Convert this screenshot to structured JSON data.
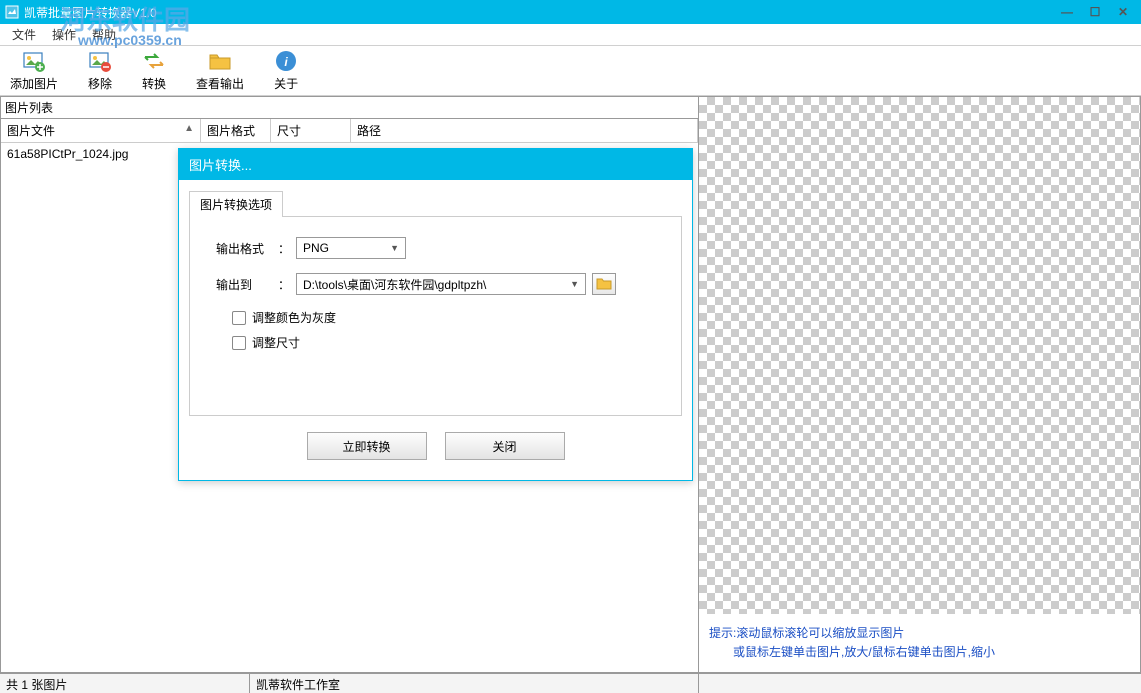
{
  "window": {
    "title": "凯蒂批量图片转换器V1.0"
  },
  "menubar": {
    "file": "文件",
    "operate": "操作",
    "help": "帮助"
  },
  "toolbar": {
    "add_image": "添加图片",
    "remove": "移除",
    "convert": "转换",
    "view_output": "查看输出",
    "about": "关于"
  },
  "watermark": {
    "text": "河东软件园",
    "url": "www.pc0359.cn"
  },
  "left_panel": {
    "title": "图片列表",
    "columns": {
      "file": "图片文件",
      "format": "图片格式",
      "size": "尺寸",
      "path": "路径"
    },
    "rows": [
      {
        "file": "61a58PICtPr_1024.jpg",
        "format": "",
        "size": "",
        "path": ""
      }
    ]
  },
  "hints": {
    "line1": "提示:滚动鼠标滚轮可以缩放显示图片",
    "line2": "　　或鼠标左键单击图片,放大/鼠标右键单击图片,缩小"
  },
  "statusbar": {
    "count": "共 1 张图片",
    "studio": "凯蒂软件工作室"
  },
  "dialog": {
    "title": "图片转换...",
    "tab": "图片转换选项",
    "output_format_label": "输出格式",
    "output_format_value": "PNG",
    "output_to_label": "输出到",
    "output_to_value": "D:\\tools\\桌面\\河东软件园\\gdpltpzh\\",
    "grayscale": "调整颜色为灰度",
    "resize": "调整尺寸",
    "convert_now": "立即转换",
    "close": "关闭",
    "colon": "："
  }
}
